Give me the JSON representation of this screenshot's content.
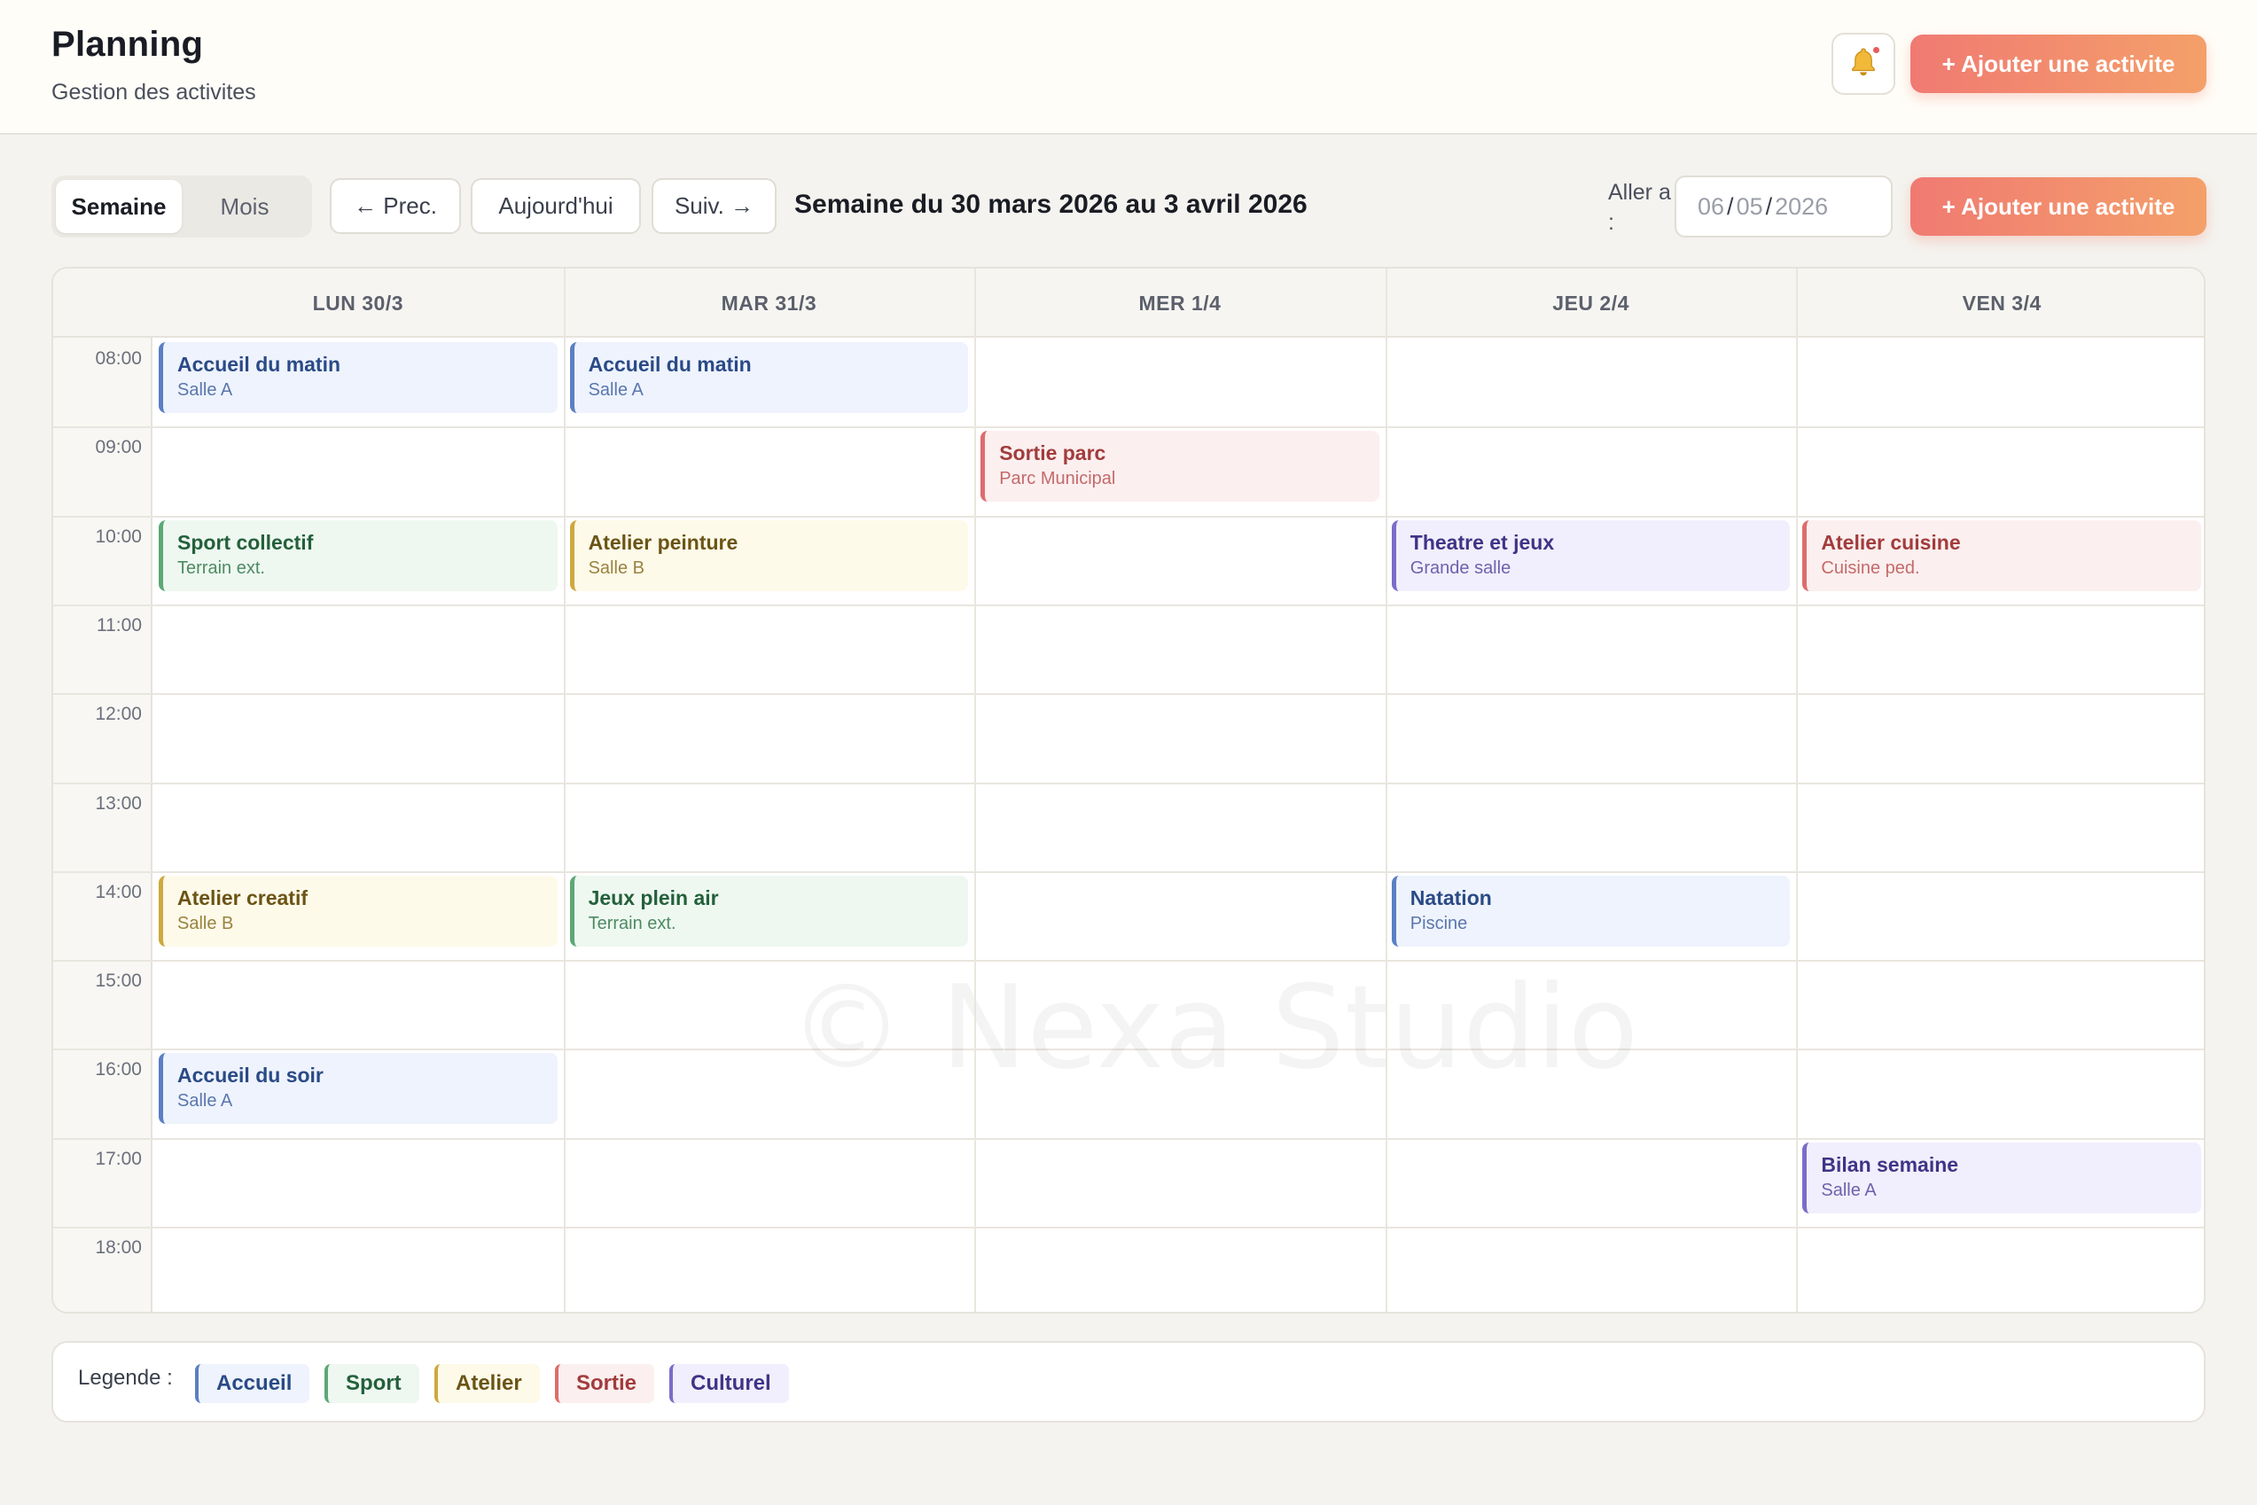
{
  "header": {
    "title": "Planning",
    "subtitle": "Gestion des activites",
    "add_label": "+ Ajouter une activite"
  },
  "toolbar": {
    "views": [
      "Semaine",
      "Mois"
    ],
    "active_view": "Semaine",
    "prev_label": "← Prec.",
    "today_label": "Aujourd'hui",
    "next_label": "Suiv. →",
    "week_range": "Semaine du 30 mars 2026 au 3 avril 2026",
    "goto_label": "Aller a :",
    "date_day": "06",
    "date_month": "05",
    "date_year": "2026",
    "add_label": "+ Ajouter une activite"
  },
  "calendar": {
    "days": [
      "LUN 30/3",
      "MAR 31/3",
      "MER 1/4",
      "JEU 2/4",
      "VEN 3/4"
    ],
    "hours": [
      "08:00",
      "09:00",
      "10:00",
      "11:00",
      "12:00",
      "13:00",
      "14:00",
      "15:00",
      "16:00",
      "17:00",
      "18:00"
    ],
    "events": [
      {
        "day": 0,
        "hour": "08:00",
        "title": "Accueil du matin",
        "location": "Salle A",
        "category": "accueil"
      },
      {
        "day": 1,
        "hour": "08:00",
        "title": "Accueil du matin",
        "location": "Salle A",
        "category": "accueil"
      },
      {
        "day": 2,
        "hour": "09:00",
        "title": "Sortie parc",
        "location": "Parc Municipal",
        "category": "sortie"
      },
      {
        "day": 0,
        "hour": "10:00",
        "title": "Sport collectif",
        "location": "Terrain ext.",
        "category": "sport"
      },
      {
        "day": 1,
        "hour": "10:00",
        "title": "Atelier peinture",
        "location": "Salle B",
        "category": "atelier"
      },
      {
        "day": 3,
        "hour": "10:00",
        "title": "Theatre et jeux",
        "location": "Grande salle",
        "category": "culturel"
      },
      {
        "day": 4,
        "hour": "10:00",
        "title": "Atelier cuisine",
        "location": "Cuisine ped.",
        "category": "sortie"
      },
      {
        "day": 0,
        "hour": "14:00",
        "title": "Atelier creatif",
        "location": "Salle B",
        "category": "atelier"
      },
      {
        "day": 1,
        "hour": "14:00",
        "title": "Jeux plein air",
        "location": "Terrain ext.",
        "category": "sport"
      },
      {
        "day": 3,
        "hour": "14:00",
        "title": "Natation",
        "location": "Piscine",
        "category": "accueil"
      },
      {
        "day": 0,
        "hour": "16:00",
        "title": "Accueil du soir",
        "location": "Salle A",
        "category": "accueil"
      },
      {
        "day": 4,
        "hour": "17:00",
        "title": "Bilan semaine",
        "location": "Salle A",
        "category": "culturel"
      }
    ]
  },
  "watermark": "© Nexa Studio",
  "legend": {
    "label": "Legende :",
    "items": [
      {
        "name": "Accueil",
        "category": "accueil"
      },
      {
        "name": "Sport",
        "category": "sport"
      },
      {
        "name": "Atelier",
        "category": "atelier"
      },
      {
        "name": "Sortie",
        "category": "sortie"
      },
      {
        "name": "Culturel",
        "category": "culturel"
      }
    ]
  },
  "colors": {
    "accent": "#f07a72",
    "accueil": "#5a7fc4",
    "sport": "#5ca876",
    "atelier": "#cfa83e",
    "sortie": "#de6c6c",
    "culturel": "#7b6cc8"
  },
  "icons": {
    "notifications": "bell-icon"
  }
}
